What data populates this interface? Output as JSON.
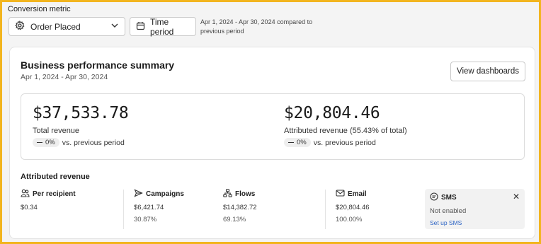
{
  "filters": {
    "metric_label": "Conversion metric",
    "metric_value": "Order Placed",
    "time_button": "Time period",
    "compare_text": "Apr 1, 2024 - Apr 30, 2024 compared to previous period"
  },
  "summary": {
    "title": "Business performance summary",
    "date_range": "Apr 1, 2024 - Apr 30, 2024",
    "view_button": "View dashboards",
    "total": {
      "value": "$37,533.78",
      "label": "Total revenue",
      "change": "0%",
      "change_suffix": "vs. previous period"
    },
    "attributed": {
      "value": "$20,804.46",
      "label": "Attributed revenue (55.43% of total)",
      "change": "0%",
      "change_suffix": "vs. previous period"
    }
  },
  "attributed_revenue": {
    "title": "Attributed revenue",
    "per_recipient": {
      "label": "Per recipient",
      "value": "$0.34"
    },
    "campaigns": {
      "label": "Campaigns",
      "value": "$6,421.74",
      "percent": "30.87%"
    },
    "flows": {
      "label": "Flows",
      "value": "$14,382.72",
      "percent": "69.13%"
    },
    "email": {
      "label": "Email",
      "value": "$20,804.46",
      "percent": "100.00%"
    },
    "sms": {
      "label": "SMS",
      "status": "Not enabled",
      "link": "Set up SMS",
      "close": "✕"
    }
  },
  "icons": {
    "metric": "settings-gear-icon",
    "calendar": "calendar-icon",
    "chevron": "chevron-down-icon",
    "per_recipient": "users-icon",
    "campaigns": "send-icon",
    "flows": "flow-icon",
    "email": "mail-icon",
    "sms": "chat-icon"
  },
  "colors": {
    "frame": "#f2b51f",
    "link": "#2b63c4"
  }
}
